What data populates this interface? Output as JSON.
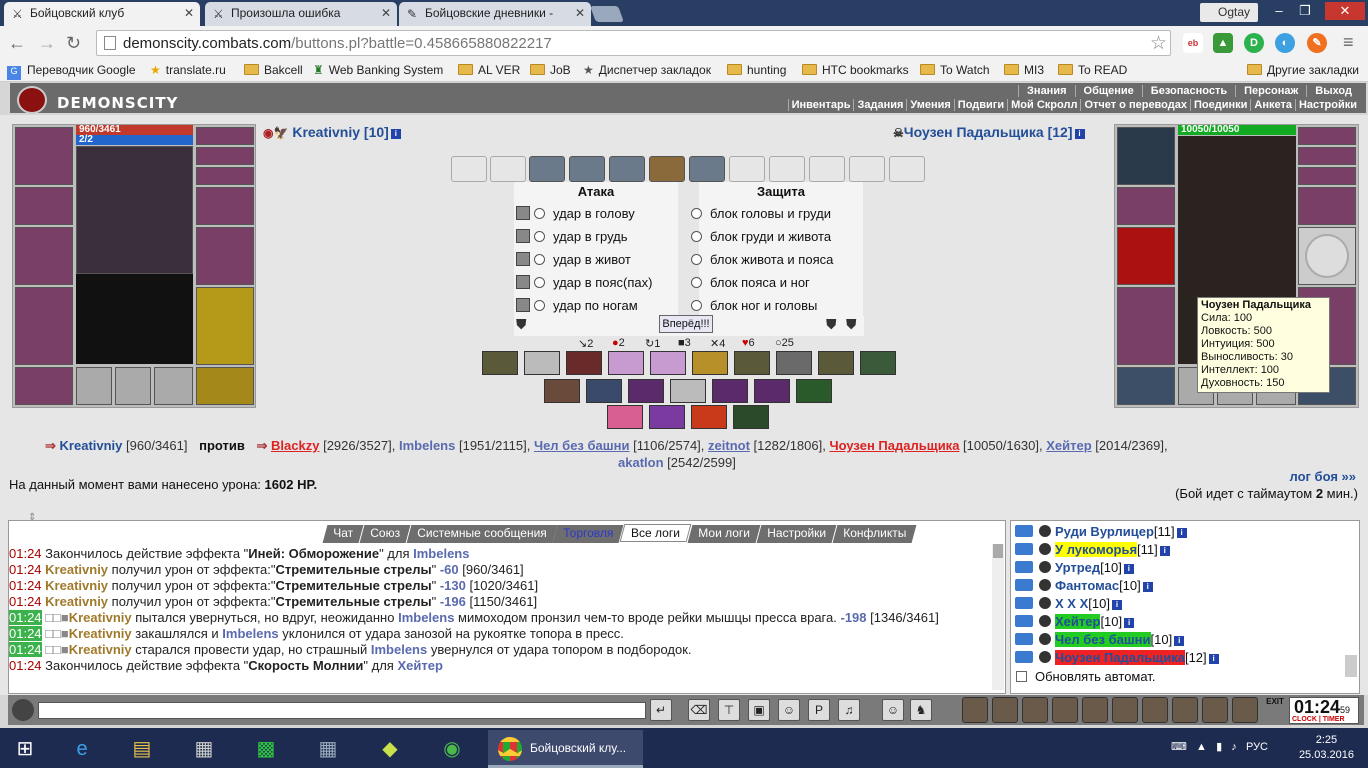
{
  "browser": {
    "tabs": [
      {
        "title": "Бойцовский клуб",
        "icon": "crossed-swords-icon",
        "active": true
      },
      {
        "title": "Произошла ошибка",
        "icon": "crossed-swords-icon",
        "active": false
      },
      {
        "title": "Бойцовские дневники - ",
        "icon": "diary-icon",
        "active": false
      }
    ],
    "profile_name": "Ogtay",
    "url_host": "demonscity.combats.com",
    "url_path": "/buttons.pl?battle=0.458665880822217",
    "bookmarks": [
      {
        "label": "Переводчик Google",
        "icon": "translate-icon"
      },
      {
        "label": "translate.ru",
        "icon": "star-icon"
      },
      {
        "label": "Bakcell",
        "icon": "folder-icon"
      },
      {
        "label": "Web Banking System",
        "icon": "bank-icon"
      },
      {
        "label": "AL VER",
        "icon": "folder-icon"
      },
      {
        "label": "JoB",
        "icon": "folder-icon"
      },
      {
        "label": "Диспетчер закладок",
        "icon": "star-icon"
      },
      {
        "label": "hunting",
        "icon": "folder-icon"
      },
      {
        "label": "HTC bookmarks",
        "icon": "folder-icon"
      },
      {
        "label": "To Watch",
        "icon": "folder-icon"
      },
      {
        "label": "MI3",
        "icon": "folder-icon"
      },
      {
        "label": "To READ",
        "icon": "folder-icon"
      }
    ],
    "other_bookmarks": "Другие закладки"
  },
  "game": {
    "logo": "DEMONSCITY",
    "top_menu": [
      "Знания",
      "Общение",
      "Безопасность",
      "Персонаж",
      "Выход"
    ],
    "sub_menu": [
      "Инвентарь",
      "Задания",
      "Умения",
      "Подвиги",
      "Мой Скролл",
      "Отчет о переводах",
      "Поединки",
      "Анкета",
      "Настройки"
    ],
    "player": {
      "name": "Kreativniy",
      "level": "[10]",
      "hp": "960/3461",
      "mana": "2/2",
      "hp_fraction": 0.277
    },
    "opponent": {
      "name": "Чоузен Падальщика",
      "level": "[12]",
      "hp": "10050/10050",
      "hp_fraction": 1.0
    },
    "attack_header": "Атака",
    "defense_header": "Защита",
    "attacks": [
      "удар в голову",
      "удар в грудь",
      "удар в живот",
      "удар в пояс(пах)",
      "удар по ногам"
    ],
    "defenses": [
      "блок головы и груди",
      "блок груди и живота",
      "блок живота и пояса",
      "блок пояса и ног",
      "блок ног и головы"
    ],
    "forward_button": "Вперёд!!!",
    "counters": [
      "2",
      "2",
      "1",
      "3",
      "4",
      "6",
      "25"
    ],
    "tooltip": {
      "name": "Чоузен Падальщика",
      "lines": [
        "Сила: 100",
        "Ловкость: 500",
        "Интуиция: 500",
        "Выносливость: 30",
        "Интеллект: 100",
        "Духовность: 150"
      ]
    },
    "versus": {
      "me": "Kreativniy",
      "me_hp": "[960/3461]",
      "vs": "против",
      "enemies": [
        {
          "name": "Blackzy",
          "hp": "[2926/3527],",
          "style": "en"
        },
        {
          "name": "Imbelens",
          "hp": "[1951/2115],",
          "style": "bl"
        },
        {
          "name": "Чел без башни",
          "hp": "[1106/2574],",
          "style": "blu"
        },
        {
          "name": "zeitnot",
          "hp": "[1282/1806],",
          "style": "blu"
        },
        {
          "name": "Чоузен Падальщика",
          "hp": "[10050/1630],",
          "style": "en"
        },
        {
          "name": "Хейтер",
          "hp": "[2014/2369],",
          "style": "blu"
        },
        {
          "name": "akatlon",
          "hp": "[2542/2599]",
          "style": "bl"
        }
      ]
    },
    "damage_text": "На данный момент вами нанесено урона:",
    "damage_value": "1602 HP.",
    "log_link": "лог боя »»",
    "timeout_pre": "(Бой идет с таймаутом",
    "timeout_val": "2",
    "timeout_post": "мин.)"
  },
  "chat": {
    "tabs": [
      "Чат",
      "Союз",
      "Системные сообщения",
      "Торговля",
      "Все логи",
      "Мои логи",
      "Настройки",
      "Конфликты"
    ],
    "selected_tab": "Все логи",
    "log": [
      {
        "time": "01:24",
        "parts": [
          "Закончилось действие эффекта \"",
          "Иней: Обморожение",
          "\" для ",
          "Imbelens"
        ]
      },
      {
        "time": "01:24",
        "parts": [
          "Kreativniy",
          " получил урон от эффекта:\"",
          "Стремительные стрелы",
          "\" ",
          "-60",
          " [960/3461]"
        ]
      },
      {
        "time": "01:24",
        "parts": [
          "Kreativniy",
          " получил урон от эффекта:\"",
          "Стремительные стрелы",
          "\" ",
          "-130",
          " [1020/3461]"
        ]
      },
      {
        "time": "01:24",
        "parts": [
          "Kreativniy",
          " получил урон от эффекта:\"",
          "Стремительные стрелы",
          "\" ",
          "-196",
          " [1150/3461]"
        ]
      },
      {
        "time": "01:24",
        "parts": [
          "Kreativniy",
          " пытался увернуться, но вдруг, неожиданно ",
          "Imbelens",
          " мимоходом пронзил чем-то вроде рейки мышцы пресса врага. ",
          "-198",
          " [1346/3461]"
        ]
      },
      {
        "time": "01:24",
        "parts": [
          "Kreativniy",
          " закашлялся и ",
          "Imbelens",
          " уклонился от удара занозой на рукоятке топора в пресс."
        ]
      },
      {
        "time": "01:24",
        "parts": [
          "Kreativniy",
          " старался провести удар, но страшный ",
          "Imbelens",
          " увернулся от удара топором в подбородок."
        ]
      },
      {
        "time": "01:24",
        "parts": [
          "Закончилось действие эффекта \"",
          "Скорость Молнии",
          "\" для ",
          "Хейтер"
        ]
      }
    ]
  },
  "online": {
    "players": [
      {
        "name": "Руди Вурлицер",
        "level": "[11]",
        "highlight": ""
      },
      {
        "name": "У лукоморья",
        "level": "[11]",
        "highlight": "#ffff00"
      },
      {
        "name": "Уртред",
        "level": "[10]",
        "highlight": ""
      },
      {
        "name": "Фантомас",
        "level": "[10]",
        "highlight": ""
      },
      {
        "name": "Х Х Х",
        "level": "[10]",
        "highlight": ""
      },
      {
        "name": "Хейтер",
        "level": "[10]",
        "highlight": "#22cc22"
      },
      {
        "name": "Чел без башни",
        "level": "[10]",
        "highlight": "#22cc22"
      },
      {
        "name": "Чоузен Падальщика",
        "level": "[12]",
        "highlight": "#ee2222"
      }
    ],
    "refresh_label": "Обновлять автомат."
  },
  "clock": {
    "time": "01:24",
    "seconds": "59",
    "label": "CLOCK | TIMER",
    "exit": "EXIT"
  },
  "taskbar": {
    "active_window": "Бойцовский клу...",
    "lang": "РУС",
    "time": "2:25",
    "date": "25.03.2016"
  },
  "colors": {
    "accent": "#234e98",
    "enemy": "#dd2222",
    "timestamp": "#aa0000",
    "hp_bar": "#c0392b",
    "mana_bar": "#2266cc",
    "opp_hp": "#11aa22"
  }
}
